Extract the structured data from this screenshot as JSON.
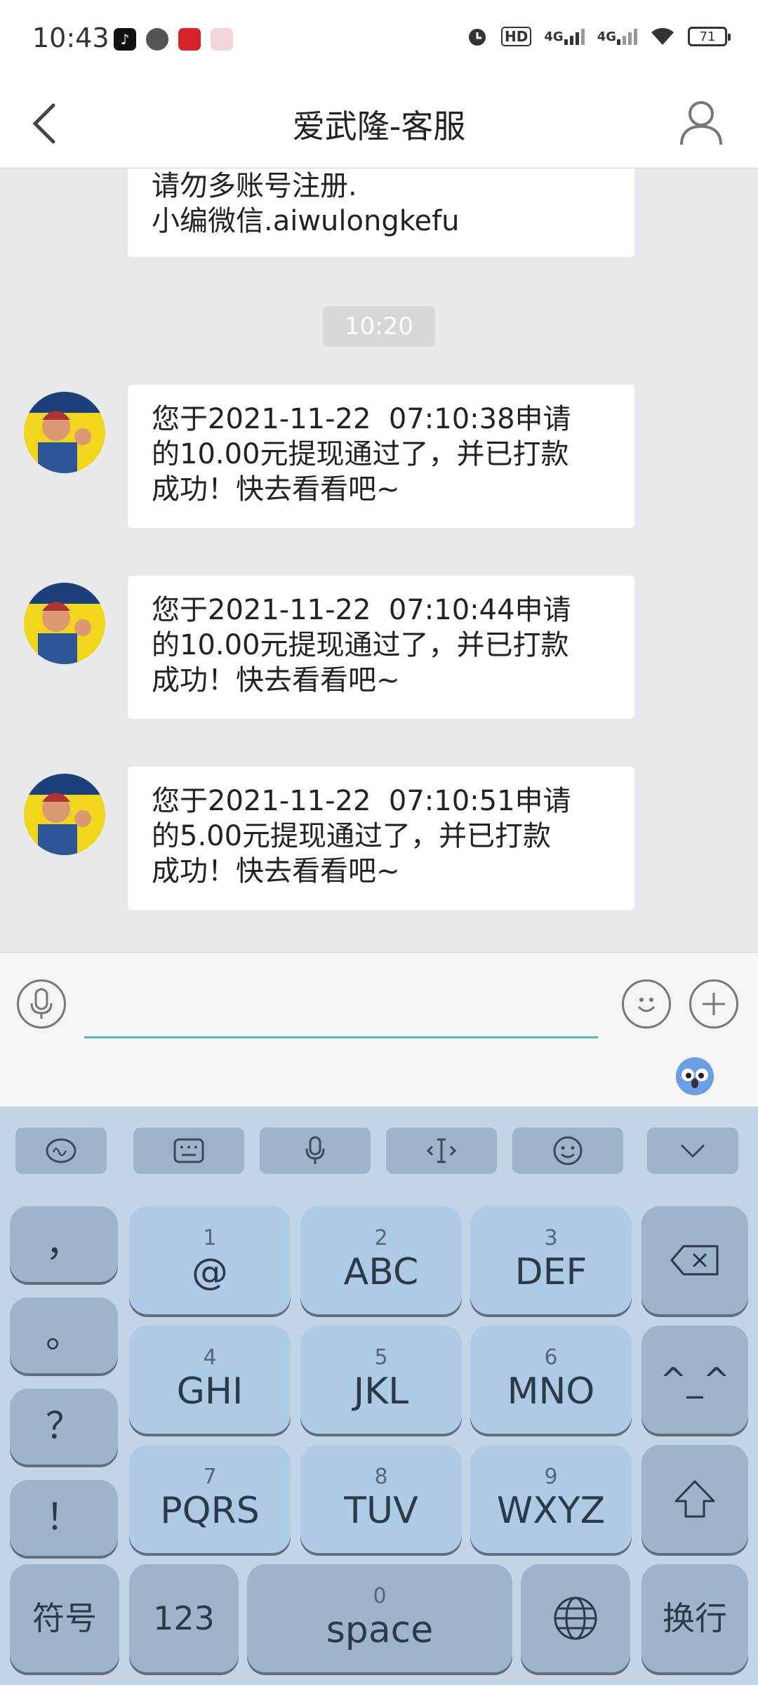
{
  "status_bar": {
    "time": "10:43",
    "battery": "71",
    "app_icons": [
      "tiktok-icon",
      "chat-bubble-icon",
      "red-app-icon",
      "stamp-app-icon"
    ],
    "right_icons": [
      "alarm-icon",
      "hd-icon",
      "4g-signal-icon",
      "4g-signal-icon",
      "wifi-icon",
      "battery-icon"
    ],
    "hd_label": "HD",
    "sig1": "4G",
    "sig2": "4G"
  },
  "header": {
    "title": "爱武隆-客服"
  },
  "chat": {
    "first_message": "请勿多账号注册.\n小编微信.aiwulongkefu",
    "time_chip": "10:20",
    "messages": [
      {
        "text": "您于2021-11-22  07:10:38申请\n的10.00元提现通过了，并已打款\n成功！快去看看吧~"
      },
      {
        "text": "您于2021-11-22  07:10:44申请\n的10.00元提现通过了，并已打款\n成功！快去看看吧~"
      },
      {
        "text": "您于2021-11-22  07:10:51申请\n的5.00元提现通过了，并已打款\n成功！快去看看吧~"
      }
    ]
  },
  "input": {
    "value": "",
    "placeholder": ""
  },
  "keyboard": {
    "left_column": [
      "，",
      "。",
      "？",
      "！"
    ],
    "keys": [
      {
        "num": "1",
        "label": "@"
      },
      {
        "num": "2",
        "label": "ABC"
      },
      {
        "num": "3",
        "label": "DEF"
      },
      {
        "num": "4",
        "label": "GHI"
      },
      {
        "num": "5",
        "label": "JKL"
      },
      {
        "num": "6",
        "label": "MNO"
      },
      {
        "num": "7",
        "label": "PQRS"
      },
      {
        "num": "8",
        "label": "TUV"
      },
      {
        "num": "9",
        "label": "WXYZ"
      }
    ],
    "emoticon": "^_^",
    "symbols": "符号",
    "numbers": "123",
    "space_num": "0",
    "space": "space",
    "enter": "换行"
  },
  "colors": {
    "accent": "#57b8b4",
    "key_light": "#aecbe5",
    "key_dark": "#9eb5c9",
    "keyboard_bg": "#c2d5e7"
  }
}
